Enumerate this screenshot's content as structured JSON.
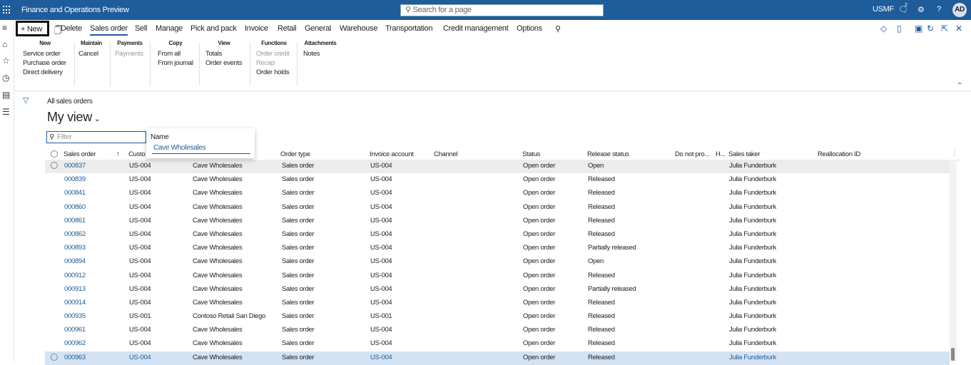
{
  "app": {
    "title": "Finance and Operations Preview",
    "search_placeholder": "Search for a page",
    "company": "USMF",
    "notif_count": "2",
    "user_initials": "AD"
  },
  "actions": {
    "new": "New",
    "delete": "Delete",
    "tabs": [
      "Sales order",
      "Sell",
      "Manage",
      "Pick and pack",
      "Invoice",
      "Retail",
      "General",
      "Warehouse",
      "Transportation",
      "Credit management",
      "Options"
    ]
  },
  "ribbon": {
    "new": {
      "header": "New",
      "items": [
        "Service order",
        "Purchase order",
        "Direct delivery"
      ]
    },
    "maintain": {
      "header": "Maintain",
      "items": [
        "Cancel"
      ]
    },
    "payments": {
      "header": "Payments",
      "items": [
        "Payments"
      ]
    },
    "copy": {
      "header": "Copy",
      "items": [
        "From all",
        "From journal"
      ]
    },
    "view": {
      "header": "View",
      "items": [
        "Totals",
        "Order events"
      ]
    },
    "functions": {
      "header": "Functions",
      "items": [
        "Order credit",
        "Recap",
        "Order holds"
      ]
    },
    "attachments": {
      "header": "Attachments",
      "items": [
        "Notes"
      ]
    }
  },
  "page": {
    "breadcrumb": "All sales orders",
    "view_title": "My view",
    "filter_placeholder": "Filter"
  },
  "filter_dropdown": {
    "label": "Name",
    "value": "Cave Wholesales"
  },
  "grid": {
    "columns": [
      "Sales order",
      "Custo",
      "Order type",
      "Invoice account",
      "Channel",
      "Status",
      "Release status",
      "Do not pro...",
      "H...",
      "Sales taker",
      "Reallocation ID"
    ],
    "rows": [
      {
        "order": "000837",
        "cust": "US-004",
        "name": "Cave Wholesales",
        "type": "Sales order",
        "inv": "US-004",
        "status": "Open order",
        "release": "Open",
        "taker": "Julia Funderburk"
      },
      {
        "order": "000839",
        "cust": "US-004",
        "name": "Cave Wholesales",
        "type": "Sales order",
        "inv": "US-004",
        "status": "Open order",
        "release": "Released",
        "taker": "Julia Funderburk"
      },
      {
        "order": "000841",
        "cust": "US-004",
        "name": "Cave Wholesales",
        "type": "Sales order",
        "inv": "US-004",
        "status": "Open order",
        "release": "Released",
        "taker": "Julia Funderburk"
      },
      {
        "order": "000860",
        "cust": "US-004",
        "name": "Cave Wholesales",
        "type": "Sales order",
        "inv": "US-004",
        "status": "Open order",
        "release": "Released",
        "taker": "Julia Funderburk"
      },
      {
        "order": "000861",
        "cust": "US-004",
        "name": "Cave Wholesales",
        "type": "Sales order",
        "inv": "US-004",
        "status": "Open order",
        "release": "Released",
        "taker": "Julia Funderburk"
      },
      {
        "order": "000862",
        "cust": "US-004",
        "name": "Cave Wholesales",
        "type": "Sales order",
        "inv": "US-004",
        "status": "Open order",
        "release": "Released",
        "taker": "Julia Funderburk"
      },
      {
        "order": "000893",
        "cust": "US-004",
        "name": "Cave Wholesales",
        "type": "Sales order",
        "inv": "US-004",
        "status": "Open order",
        "release": "Partially released",
        "taker": "Julia Funderburk"
      },
      {
        "order": "000894",
        "cust": "US-004",
        "name": "Cave Wholesales",
        "type": "Sales order",
        "inv": "US-004",
        "status": "Open order",
        "release": "Open",
        "taker": "Julia Funderburk"
      },
      {
        "order": "000912",
        "cust": "US-004",
        "name": "Cave Wholesales",
        "type": "Sales order",
        "inv": "US-004",
        "status": "Open order",
        "release": "Released",
        "taker": "Julia Funderburk"
      },
      {
        "order": "000913",
        "cust": "US-004",
        "name": "Cave Wholesales",
        "type": "Sales order",
        "inv": "US-004",
        "status": "Open order",
        "release": "Partially released",
        "taker": "Julia Funderburk"
      },
      {
        "order": "000914",
        "cust": "US-004",
        "name": "Cave Wholesales",
        "type": "Sales order",
        "inv": "US-004",
        "status": "Open order",
        "release": "Released",
        "taker": "Julia Funderburk"
      },
      {
        "order": "000935",
        "cust": "US-001",
        "name": "Contoso Retail San Diego",
        "type": "Sales order",
        "inv": "US-001",
        "status": "Open order",
        "release": "Released",
        "taker": "Julia Funderburk"
      },
      {
        "order": "000961",
        "cust": "US-004",
        "name": "Cave Wholesales",
        "type": "Sales order",
        "inv": "US-004",
        "status": "Open order",
        "release": "Released",
        "taker": "Julia Funderburk"
      },
      {
        "order": "000962",
        "cust": "US-004",
        "name": "Cave Wholesales",
        "type": "Sales order",
        "inv": "US-004",
        "status": "Open order",
        "release": "Released",
        "taker": "Julia Funderburk"
      },
      {
        "order": "000963",
        "cust": "US-004",
        "name": "Cave Wholesales",
        "type": "Sales order",
        "inv": "US-004",
        "status": "Open order",
        "release": "Released",
        "taker": "Julia Funderburk"
      }
    ]
  }
}
